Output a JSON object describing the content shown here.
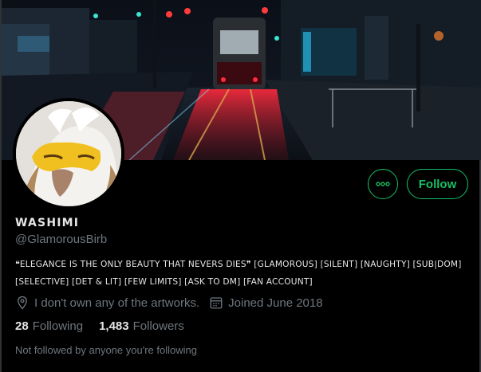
{
  "profile": {
    "display_name": "WASHIMI",
    "handle": "@GlamorousBirb",
    "bio": "❝ELEGANCE IS THE ONLY BEAUTY THAT  NEVERS DIES❞ [GLAMOROUS] [SILENT] [NAUGHTY] [SUB|DOM] [SELECTIVE] [DET & LIT] [FEW LIMITS] [ASK TO DM] [FAN ACCOUNT]",
    "location": "I don't own any of the artworks.",
    "joined": "Joined June 2018",
    "following_count": "28",
    "following_label": "Following",
    "followers_count": "1,483",
    "followers_label": "Followers",
    "followed_by_note": "Not followed by anyone you're following"
  },
  "actions": {
    "more_icon": "more-dots-icon",
    "follow_label": "Follow"
  },
  "icons": {
    "location": "location-pin-icon",
    "calendar": "calendar-icon"
  },
  "colors": {
    "accent": "#17bf63",
    "background": "#000000",
    "secondary_text": "#6e767d",
    "primary_text": "#e6e6e6"
  }
}
